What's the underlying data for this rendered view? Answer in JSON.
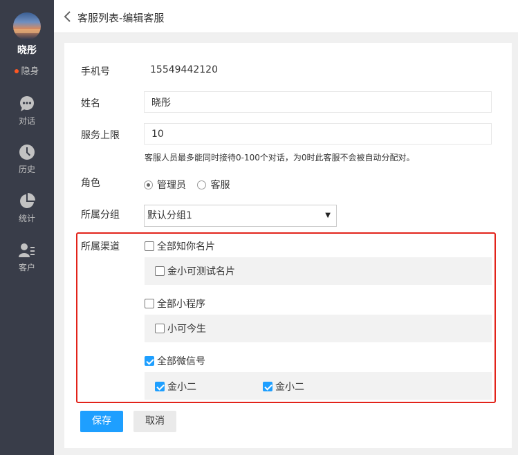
{
  "sidebar": {
    "user": {
      "name": "晓彤",
      "status": "隐身",
      "status_color": "#ff5722"
    },
    "nav": [
      {
        "label": "对话",
        "icon": "chat-bubble-icon"
      },
      {
        "label": "历史",
        "icon": "clock-icon"
      },
      {
        "label": "统计",
        "icon": "pie-chart-icon"
      },
      {
        "label": "客户",
        "icon": "user-list-icon"
      }
    ],
    "bg_color": "#393d49"
  },
  "header": {
    "title": "客服列表-编辑客服"
  },
  "form": {
    "phone": {
      "label": "手机号",
      "value": "15549442120"
    },
    "name": {
      "label": "姓名",
      "value": "晓彤"
    },
    "limit": {
      "label": "服务上限",
      "value": "10",
      "hint": "客服人员最多能同时接待0-100个对话，为0时此客服不会被自动分配对。"
    },
    "role": {
      "label": "角色",
      "options": [
        {
          "label": "管理员",
          "selected": true
        },
        {
          "label": "客服",
          "selected": false
        }
      ]
    },
    "group": {
      "label": "所属分组",
      "selected": "默认分组1"
    },
    "channels": {
      "label": "所属渠道",
      "groups": [
        {
          "label": "全部知你名片",
          "checked": false,
          "items": [
            {
              "label": "金小可测试名片",
              "checked": false
            }
          ]
        },
        {
          "label": "全部小程序",
          "checked": false,
          "items": [
            {
              "label": "小可今生",
              "checked": false
            }
          ]
        },
        {
          "label": "全部微信号",
          "checked": true,
          "items": [
            {
              "label": "金小二",
              "checked": true
            },
            {
              "label": "金小二",
              "checked": true
            }
          ]
        }
      ]
    }
  },
  "buttons": {
    "save": "保存",
    "cancel": "取消"
  },
  "colors": {
    "primary": "#1e9fff",
    "highlight_border": "#e2231a"
  }
}
